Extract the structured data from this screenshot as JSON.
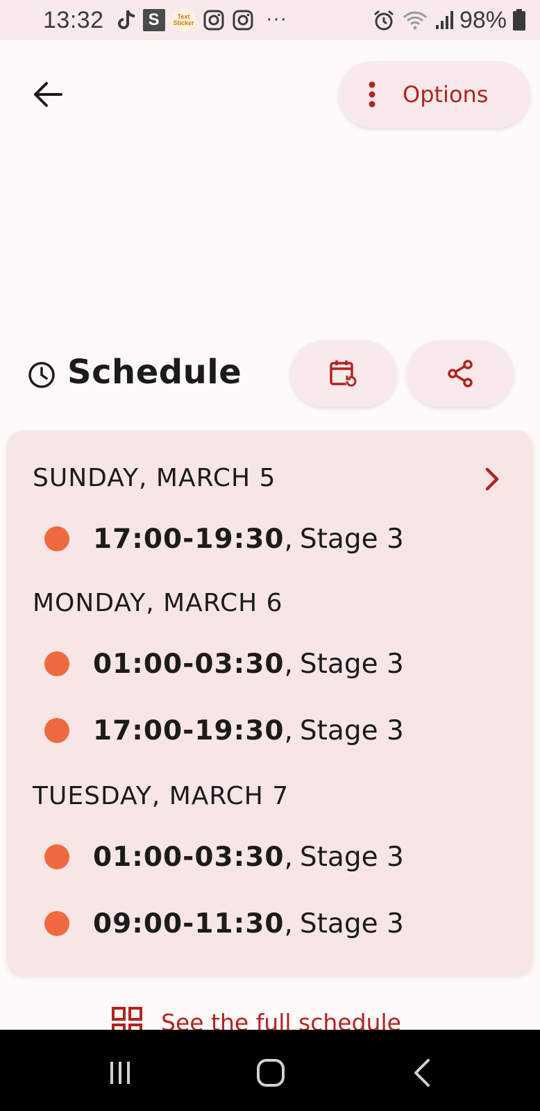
{
  "status_bar": {
    "time": "13:32",
    "sticker_line1": "Text",
    "sticker_line2": "Sticker",
    "s_badge": "S",
    "more_dots": "···",
    "battery": "98%"
  },
  "header": {
    "options_label": "Options"
  },
  "schedule": {
    "title": "Schedule",
    "days": [
      {
        "label": "SUNDAY, MARCH 5",
        "slots": [
          {
            "time": "17:00-19:30",
            "location": "Stage 3"
          }
        ]
      },
      {
        "label": "MONDAY, MARCH 6",
        "slots": [
          {
            "time": "01:00-03:30",
            "location": "Stage 3"
          },
          {
            "time": "17:00-19:30",
            "location": "Stage 3"
          }
        ]
      },
      {
        "label": "TUESDAY, MARCH 7",
        "slots": [
          {
            "time": "01:00-03:30",
            "location": "Stage 3"
          },
          {
            "time": "09:00-11:30",
            "location": "Stage 3"
          }
        ]
      }
    ],
    "separator": ",",
    "full_schedule_label": "See the full schedule"
  },
  "colors": {
    "accent": "#b3231f",
    "dot": "#ef6a3e",
    "card_bg": "#f8e6e6"
  }
}
